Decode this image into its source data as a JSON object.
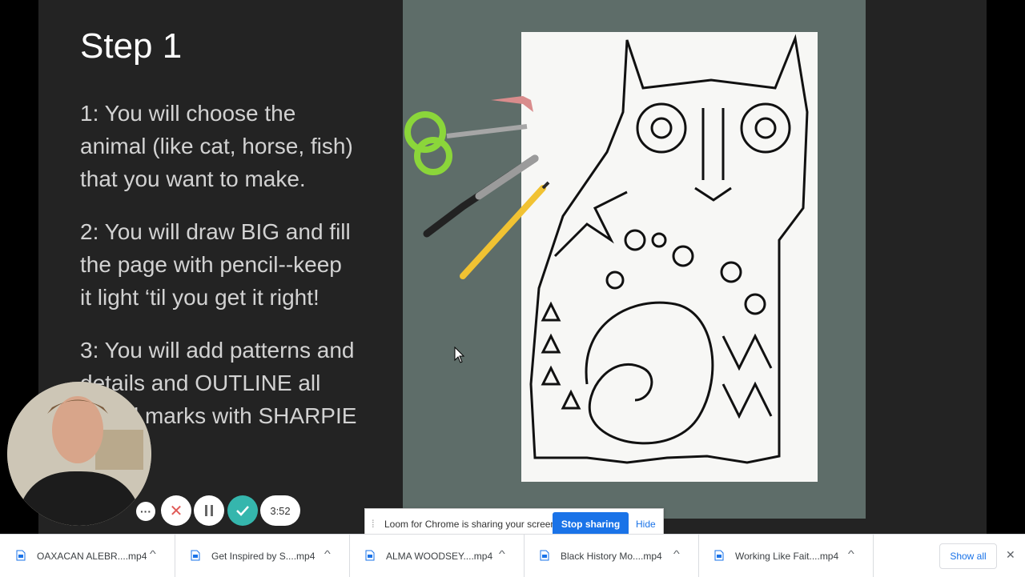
{
  "slide": {
    "title": "Step 1",
    "steps": [
      {
        "lines": [
          "1: You will choose the",
          "animal (like cat, horse, fish)",
          "that you want to make."
        ]
      },
      {
        "lines": [
          "2: You will draw BIG and fill",
          "the page with pencil--keep",
          "it light ‘til you get it right!"
        ]
      },
      {
        "lines": [
          "3: You will add patterns and",
          "details and OUTLINE all",
          "pencil marks with SHARPIE"
        ]
      }
    ]
  },
  "recorder": {
    "more_icon": "more-horizontal-icon",
    "cancel_icon": "close-icon",
    "pause_icon": "pause-icon",
    "done_icon": "check-icon",
    "timer": "3:52",
    "accent_color": "#35b6ad"
  },
  "share_bar": {
    "message": "Loom for Chrome is sharing your screen.",
    "stop_label": "Stop sharing",
    "hide_label": "Hide",
    "button_color": "#1a73e8"
  },
  "downloads": {
    "items": [
      {
        "name": "OAXACAN ALEBR....mp4",
        "icon": "video-file-icon"
      },
      {
        "name": "Get Inspired by S....mp4",
        "icon": "video-file-icon"
      },
      {
        "name": "ALMA WOODSEY....mp4",
        "icon": "video-file-icon"
      },
      {
        "name": "Black History Mo....mp4",
        "icon": "video-file-icon"
      },
      {
        "name": "Working Like Fait....mp4",
        "icon": "video-file-icon"
      }
    ],
    "show_all_label": "Show all",
    "close_icon": "close-icon"
  }
}
